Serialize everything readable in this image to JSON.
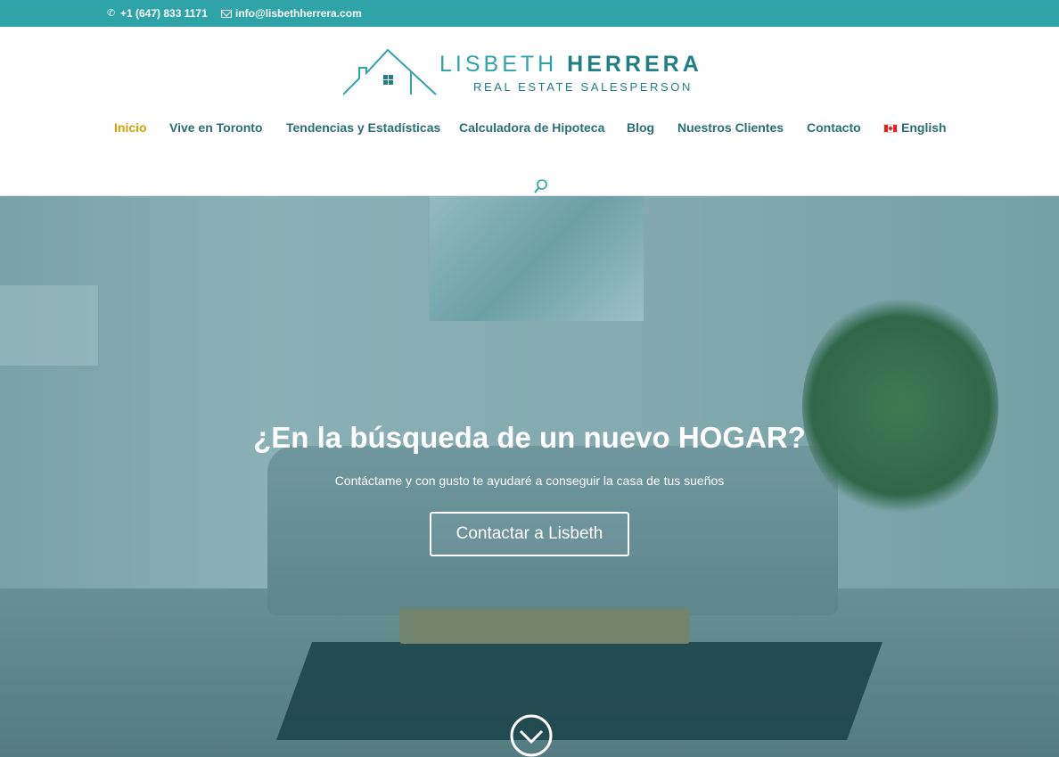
{
  "topbar": {
    "phone": "+1 (647) 833 1171",
    "email": "info@lisbethherrera.com",
    "phone_icon": "phone-icon",
    "email_icon": "envelope-icon"
  },
  "logo": {
    "name_first": "LISBETH",
    "name_last": "HERRERA",
    "tagline": "REAL ESTATE SALESPERSON"
  },
  "nav": {
    "items": [
      {
        "label": "Inicio",
        "active": true
      },
      {
        "label": "Vive en Toronto"
      },
      {
        "label": "Tendencias y Estadísticas"
      },
      {
        "label": "Calculadora de Hipoteca"
      },
      {
        "label": "Blog"
      },
      {
        "label": "Nuestros Clientes"
      },
      {
        "label": "Contacto"
      },
      {
        "label": "English"
      }
    ]
  },
  "hero": {
    "title": "¿En la búsqueda de un nuevo HOGAR?",
    "subtitle": "Contáctame y con gusto te ayudaré a conseguir la casa de tus sueños",
    "cta_label": "Contactar a Lisbeth"
  },
  "colors": {
    "brand": "#2ea3a8",
    "brand_dark": "#1f7f85",
    "nav_text": "#2a6f73",
    "nav_active": "#d5a000"
  }
}
